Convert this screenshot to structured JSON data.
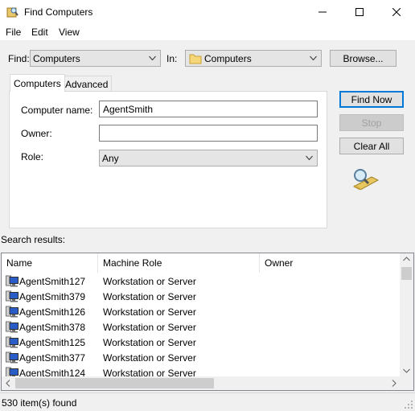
{
  "window": {
    "title": "Find Computers"
  },
  "menu": {
    "items": [
      "File",
      "Edit",
      "View"
    ]
  },
  "find_bar": {
    "find_label": "Find:",
    "find_value": "Computers",
    "in_label": "In:",
    "in_value": "Computers",
    "browse_label": "Browse..."
  },
  "tabs": [
    "Computers",
    "Advanced"
  ],
  "form": {
    "computer_name_label": "Computer name:",
    "computer_name_value": "AgentSmith",
    "owner_label": "Owner:",
    "owner_value": "",
    "role_label": "Role:",
    "role_value": "Any"
  },
  "actions": {
    "find_now": "Find Now",
    "stop": "Stop",
    "clear_all": "Clear All"
  },
  "results": {
    "label": "Search results:",
    "columns": [
      "Name",
      "Machine Role",
      "Owner"
    ],
    "rows": [
      {
        "name": "AgentSmith127",
        "role": "Workstation or Server"
      },
      {
        "name": "AgentSmith379",
        "role": "Workstation or Server"
      },
      {
        "name": "AgentSmith126",
        "role": "Workstation or Server"
      },
      {
        "name": "AgentSmith378",
        "role": "Workstation or Server"
      },
      {
        "name": "AgentSmith125",
        "role": "Workstation or Server"
      },
      {
        "name": "AgentSmith377",
        "role": "Workstation or Server"
      },
      {
        "name": "AgentSmith124",
        "role": "Workstation or Server"
      }
    ]
  },
  "status": {
    "text": "530 item(s) found"
  }
}
